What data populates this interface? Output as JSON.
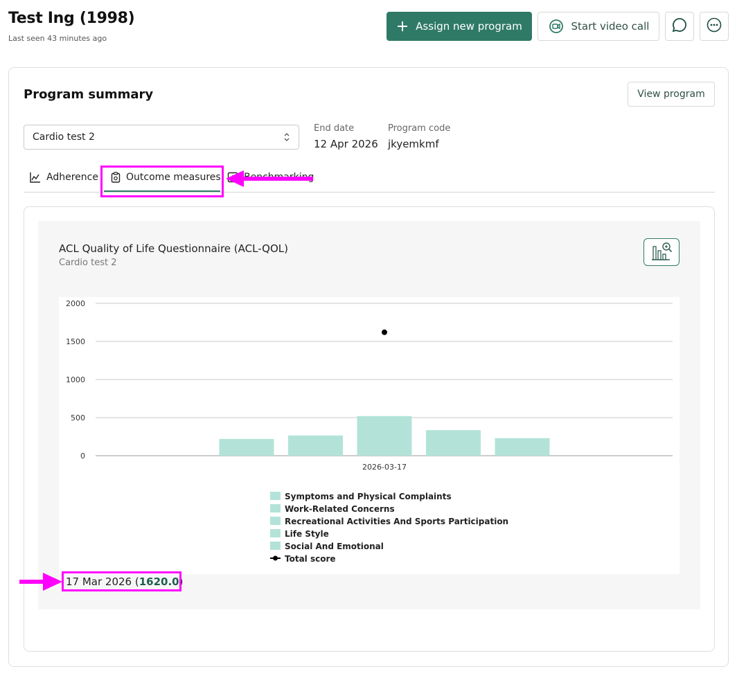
{
  "header": {
    "patient_name": "Test Ing (1998)",
    "last_seen": "Last seen 43 minutes ago"
  },
  "actions": {
    "assign_label": "Assign new program",
    "video_label": "Start video call"
  },
  "summary": {
    "title": "Program summary",
    "view_program_label": "View program",
    "program_select_value": "Cardio test 2",
    "end_date_label": "End date",
    "end_date_value": "12 Apr 2026",
    "code_label": "Program code",
    "code_value": "jkyemkmf"
  },
  "tabs": {
    "adherence": "Adherence",
    "outcome": "Outcome measures",
    "benchmarking": "Benchmarking"
  },
  "questionnaire": {
    "title": "ACL Quality of Life Questionnaire (ACL-QOL)",
    "subtitle": "Cardio test 2",
    "date": "17 Mar 2026",
    "score": "1620.0"
  },
  "colors": {
    "accent": "#2f7a66",
    "bar": "#b3e3d8",
    "annotation": "#ff00ff"
  },
  "chart_data": {
    "type": "bar",
    "categories": [
      "2026-03-17"
    ],
    "ylim": [
      0,
      2000
    ],
    "yticks": [
      "0",
      "500",
      "1000",
      "1500",
      "2000"
    ],
    "series": [
      {
        "name": "Symptoms and Physical Complaints",
        "values": [
          220
        ]
      },
      {
        "name": "Work-Related Concerns",
        "values": [
          265
        ]
      },
      {
        "name": "Recreational Activities And Sports Participation",
        "values": [
          520
        ]
      },
      {
        "name": "Life Style",
        "values": [
          335
        ]
      },
      {
        "name": "Social And Emotional",
        "values": [
          230
        ]
      }
    ],
    "line_series": {
      "name": "Total score",
      "values": [
        1620
      ]
    },
    "grid": true,
    "legend": "bottom"
  }
}
